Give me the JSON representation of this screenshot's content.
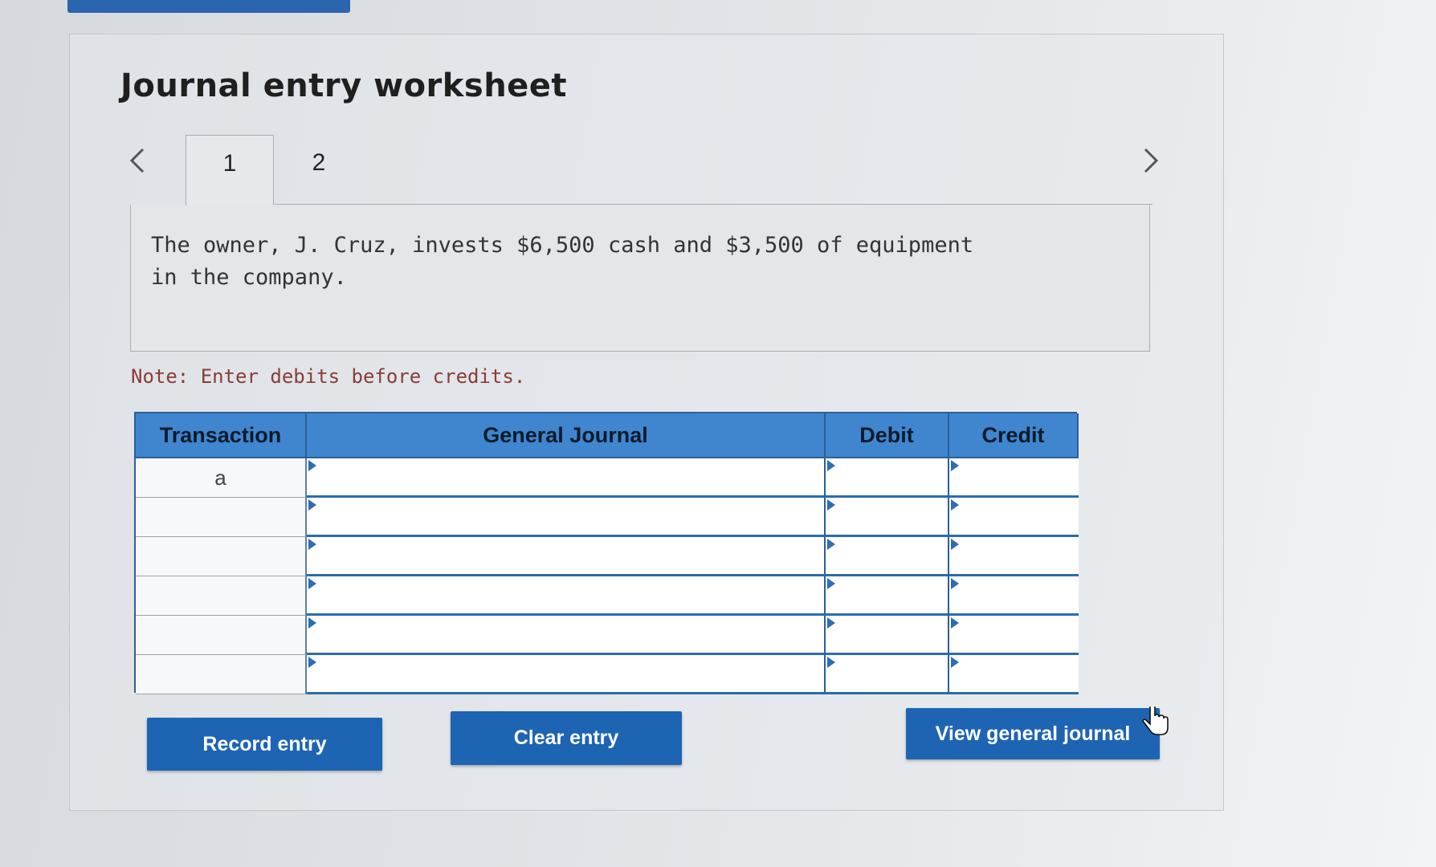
{
  "page": {
    "title": "Journal entry worksheet"
  },
  "tabs": {
    "items": [
      "1",
      "2"
    ],
    "active": "1"
  },
  "question": {
    "text": "The owner, J. Cruz, invests $6,500 cash and $3,500 of equipment in the company."
  },
  "note": "Note: Enter debits before credits.",
  "journal": {
    "headers": {
      "transaction": "Transaction",
      "general_journal": "General Journal",
      "debit": "Debit",
      "credit": "Credit"
    },
    "rows": [
      {
        "transaction": "a"
      },
      {
        "transaction": ""
      },
      {
        "transaction": ""
      },
      {
        "transaction": ""
      },
      {
        "transaction": ""
      },
      {
        "transaction": ""
      }
    ]
  },
  "buttons": {
    "record": "Record entry",
    "clear": "Clear entry",
    "view_journal": "View general journal"
  },
  "colors": {
    "accent": "#1d64b3",
    "header": "#3f86cf",
    "note": "#8a3c38"
  }
}
